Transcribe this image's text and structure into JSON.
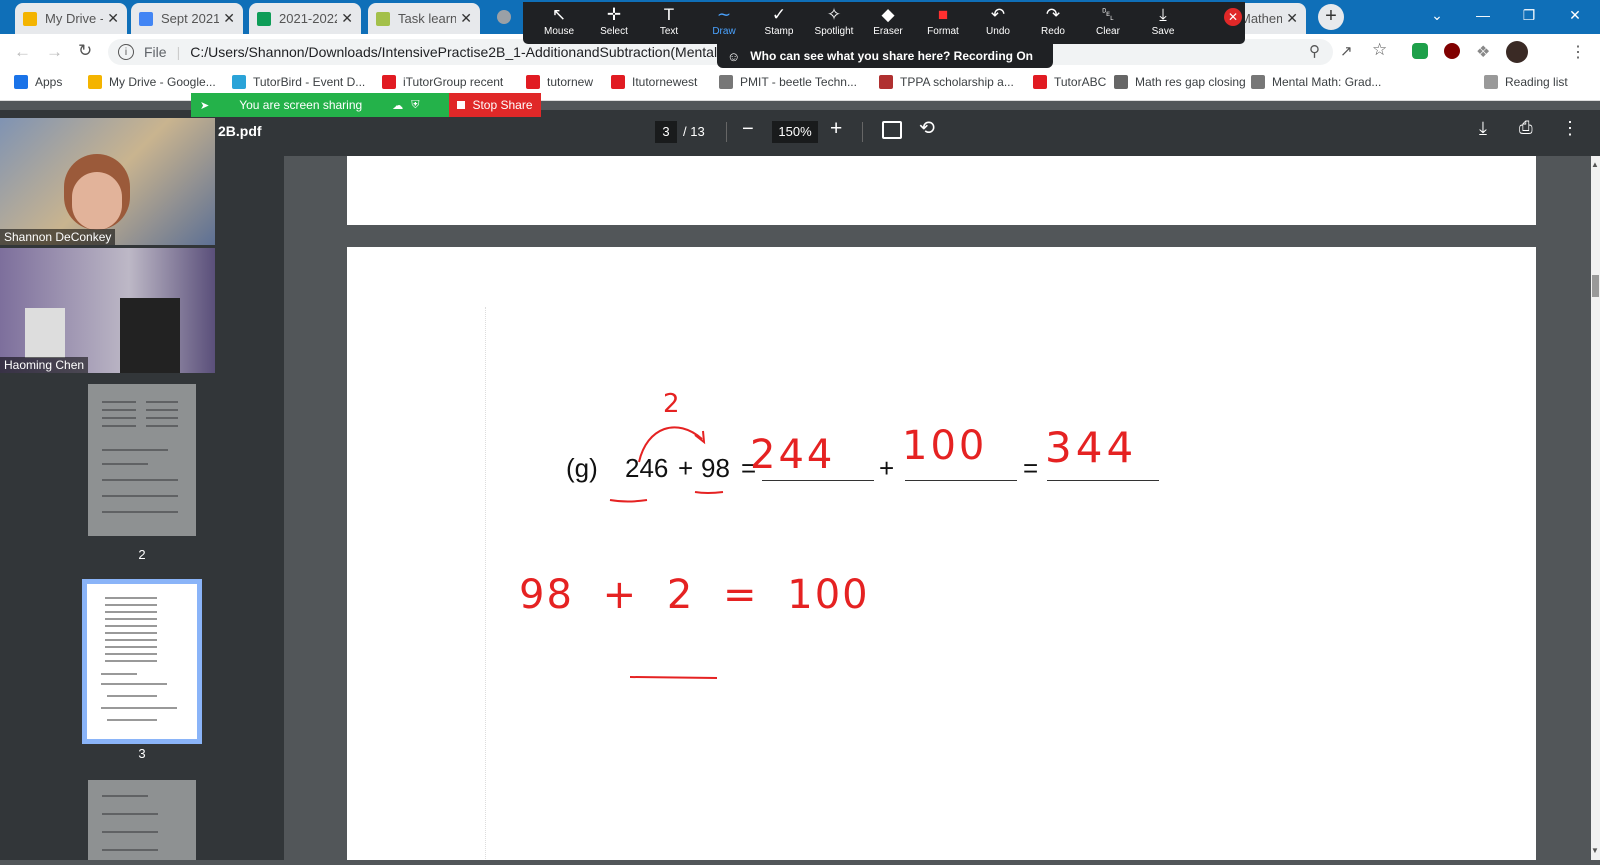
{
  "browser": {
    "tabs": [
      {
        "title": "My Drive -",
        "color": "#f4b400"
      },
      {
        "title": "Sept 2021",
        "color": "#4285f4"
      },
      {
        "title": "2021-2022",
        "color": "#0f9d58"
      },
      {
        "title": "Task learn",
        "color": "#a3c04a"
      },
      {
        "title": "Mathemat",
        "color": "#888888"
      }
    ],
    "address": {
      "scheme": "File",
      "url": "C:/Users/Shannon/Downloads/IntensivePractise2B_1-AdditionandSubtraction(MentalCa"
    },
    "bookmarks": [
      {
        "label": "Apps",
        "color": "#1a73e8"
      },
      {
        "label": "My Drive - Google...",
        "color": "#f4b400"
      },
      {
        "label": "TutorBird - Event D...",
        "color": "#2aa3d8"
      },
      {
        "label": "iTutorGroup recent",
        "color": "#e11b22"
      },
      {
        "label": "tutornew",
        "color": "#e11b22"
      },
      {
        "label": "Itutornewest",
        "color": "#e11b22"
      },
      {
        "label": "PMIT - beetle Techn...",
        "color": "#777777"
      },
      {
        "label": "TPPA scholarship a...",
        "color": "#b03030"
      },
      {
        "label": "TutorABC",
        "color": "#e11b22"
      },
      {
        "label": "Math res gap closing",
        "color": "#666666"
      },
      {
        "label": "Mental Math: Grad...",
        "color": "#777777"
      },
      {
        "label": "Reading list",
        "color": "#999999"
      }
    ]
  },
  "zoom": {
    "tools": [
      {
        "label": "Mouse",
        "icon": "↖"
      },
      {
        "label": "Select",
        "icon": "✛"
      },
      {
        "label": "Text",
        "icon": "T"
      },
      {
        "label": "Draw",
        "icon": "∼"
      },
      {
        "label": "Stamp",
        "icon": "✓"
      },
      {
        "label": "Spotlight",
        "icon": "✧"
      },
      {
        "label": "Eraser",
        "icon": "◆"
      },
      {
        "label": "Format",
        "icon": "■"
      },
      {
        "label": "Undo",
        "icon": "↶"
      },
      {
        "label": "Redo",
        "icon": "↷"
      },
      {
        "label": "Clear",
        "icon": "␡"
      },
      {
        "label": "Save",
        "icon": "⤓"
      }
    ],
    "active_tool": "Draw",
    "recording_text": "Who can see what you share here? Recording On",
    "sharing_text": "You are screen sharing",
    "stop_label": "Stop Share",
    "participants": [
      "Shannon DeConkey",
      "Haoming Chen"
    ]
  },
  "pdf": {
    "filename": "2B.pdf",
    "page_current": "3",
    "page_total": "/ 13",
    "zoom": "150%",
    "thumb_labels": [
      "2",
      "3"
    ],
    "problem": {
      "label": "(g)",
      "a": "246",
      "plus1": "+",
      "b": "98",
      "eq1": "=",
      "plus2": "+",
      "eq2": "="
    },
    "handwriting": {
      "carry": "2",
      "answer1": "244",
      "answer2": "100",
      "answer3": "344",
      "work": "98 + 2 = 100"
    }
  }
}
